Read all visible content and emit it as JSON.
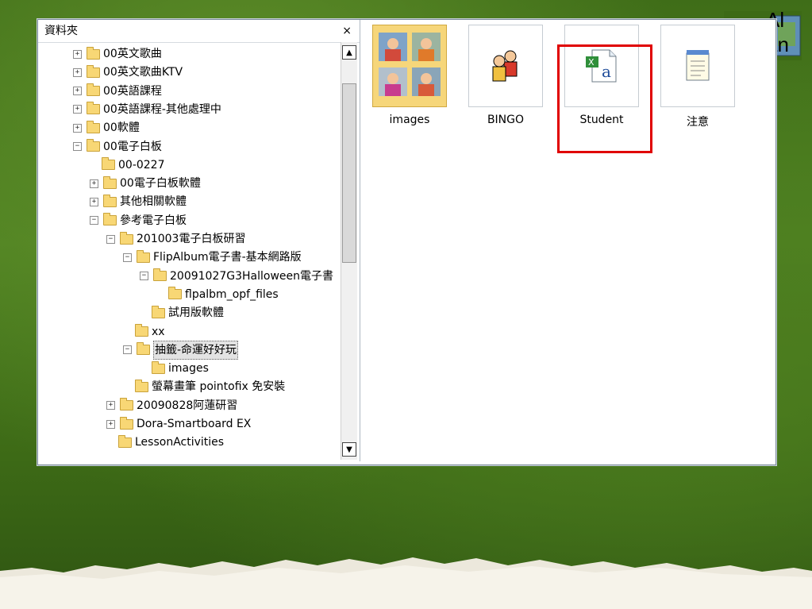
{
  "folder_pane": {
    "title": "資料夾",
    "close": "×",
    "items": [
      {
        "label": "00英文歌曲",
        "expander": "+",
        "depth": 0
      },
      {
        "label": "00英文歌曲KTV",
        "expander": "+",
        "depth": 0
      },
      {
        "label": "00英語課程",
        "expander": "+",
        "depth": 0
      },
      {
        "label": "00英語課程-其他處理中",
        "expander": "+",
        "depth": 0
      },
      {
        "label": "00軟體",
        "expander": "+",
        "depth": 0
      },
      {
        "label": "00電子白板",
        "expander": "−",
        "depth": 0
      },
      {
        "label": "00-0227",
        "expander": "",
        "depth": 1
      },
      {
        "label": "00電子白板軟體",
        "expander": "+",
        "depth": 1
      },
      {
        "label": "其他相關軟體",
        "expander": "+",
        "depth": 1
      },
      {
        "label": "參考電子白板",
        "expander": "−",
        "depth": 1
      },
      {
        "label": "201003電子白板研習",
        "expander": "−",
        "depth": 2
      },
      {
        "label": "FlipAlbum電子書-基本網路版",
        "expander": "−",
        "depth": 3
      },
      {
        "label": "20091027G3Halloween電子書",
        "expander": "−",
        "depth": 4
      },
      {
        "label": "flpalbm_opf_files",
        "expander": "",
        "depth": 5
      },
      {
        "label": "試用版軟體",
        "expander": "",
        "depth": 4
      },
      {
        "label": "xx",
        "expander": "",
        "depth": 3
      },
      {
        "label": "抽籤-命運好好玩",
        "expander": "−",
        "depth": 3
      },
      {
        "label": "images",
        "expander": "",
        "depth": 4
      },
      {
        "label": "螢幕畫筆 pointofix 免安裝",
        "expander": "",
        "depth": 3
      },
      {
        "label": "20090828阿蓮研習",
        "expander": "+",
        "depth": 2
      },
      {
        "label": "Dora-Smartboard EX",
        "expander": "+",
        "depth": 2
      },
      {
        "label": "LessonActivities",
        "expander": "",
        "depth": 2
      }
    ]
  },
  "files": [
    {
      "label": "images",
      "icon": "folder-photos-icon"
    },
    {
      "label": "BINGO",
      "icon": "children-icon"
    },
    {
      "label": "Student",
      "icon": "excel-file-icon"
    },
    {
      "label": "注意",
      "icon": "notepad-icon"
    }
  ],
  "corner": {
    "text": "Al an"
  },
  "colors": {
    "highlight": "#e00000",
    "folder": "#f8d775"
  }
}
